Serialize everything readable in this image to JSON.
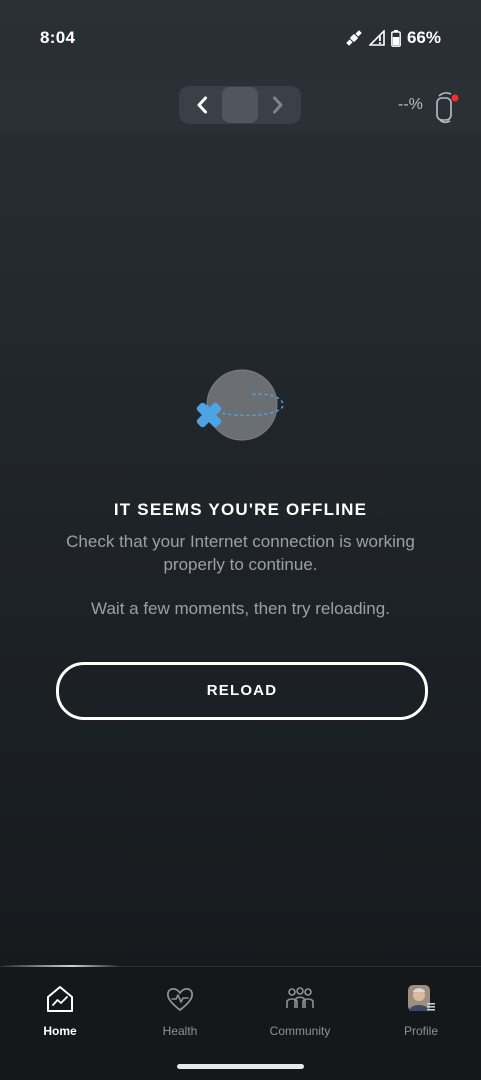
{
  "status": {
    "time": "8:04",
    "battery": "66%"
  },
  "header": {
    "device_battery": "--%"
  },
  "offline": {
    "title": "IT SEEMS YOU'RE OFFLINE",
    "line1": "Check that your Internet connection is working properly to continue.",
    "line2": "Wait a few moments, then try reloading.",
    "reload_label": "RELOAD"
  },
  "nav": {
    "home": "Home",
    "health": "Health",
    "community": "Community",
    "profile": "Profile"
  },
  "colors": {
    "accent_x": "#4ea3e4",
    "notification_dot": "#ff2a2a"
  }
}
